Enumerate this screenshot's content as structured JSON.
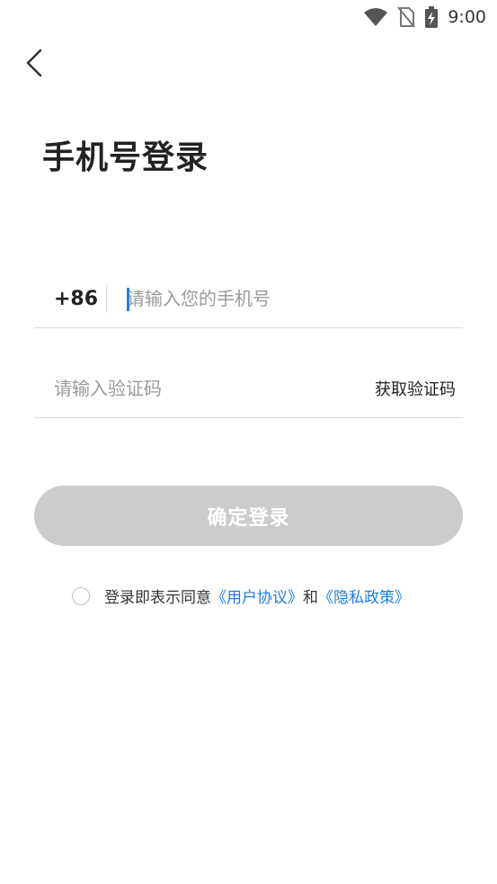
{
  "status_bar": {
    "time": "9:00",
    "icons": [
      "wifi-icon",
      "no-sim-icon",
      "battery-charging-icon"
    ]
  },
  "header": {
    "back_icon": "chevron-left-icon",
    "title": "手机号登录"
  },
  "phone_field": {
    "country_code": "+86",
    "value": "",
    "placeholder": "请输入您的手机号"
  },
  "code_field": {
    "value": "",
    "placeholder": "请输入验证码",
    "get_code_label": "获取验证码"
  },
  "login_button": {
    "label": "确定登录"
  },
  "agreement": {
    "prefix": "登录即表示同意",
    "user_agreement": "《用户协议》",
    "conjunction": "和",
    "privacy_policy": "《隐私政策》",
    "link_color": "#1f7fd6"
  },
  "colors": {
    "button_disabled": "#cccccc",
    "caret": "#2a7de1"
  }
}
